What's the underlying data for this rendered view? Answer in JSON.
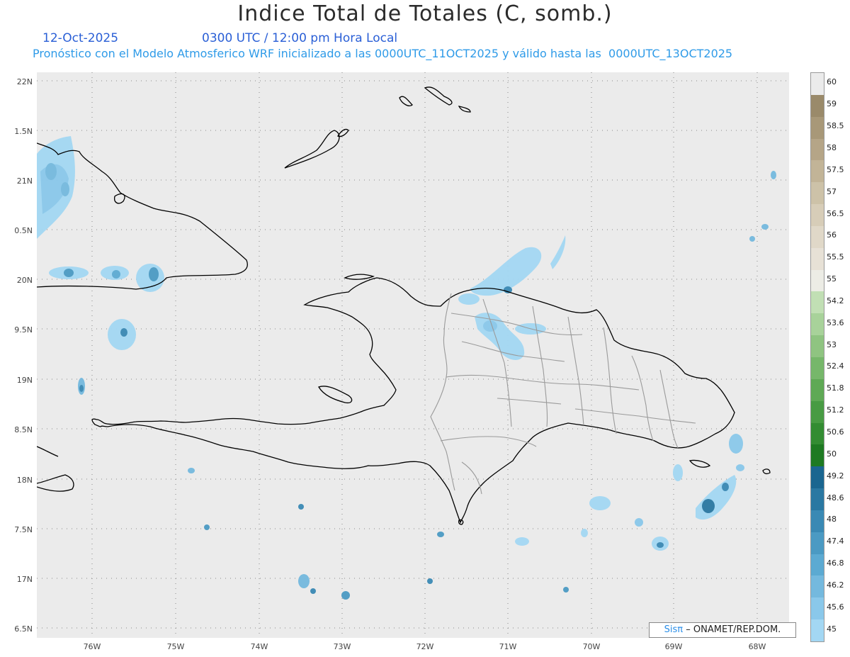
{
  "header": {
    "title": "Indice Total de Totales (C, somb.)",
    "date": "12-Oct-2025",
    "time": "0300 UTC / 12:00 pm Hora Local",
    "subtitle": "Pronóstico con el Modelo Atmosferico WRF inicializado a las 0000UTC_11OCT2025 y válido hasta las  0000UTC_13OCT2025"
  },
  "map": {
    "lat_labels": [
      "22N",
      "1.5N",
      "21N",
      "0.5N",
      "20N",
      "9.5N",
      "19N",
      "8.5N",
      "18N",
      "7.5N",
      "17N",
      "6.5N"
    ],
    "lon_labels": [
      "76W",
      "75W",
      "74W",
      "73W",
      "72W",
      "71W",
      "70W",
      "69W",
      "68W"
    ],
    "background_color": "#ebebeb",
    "coast_color": "#000000",
    "province_color": "#9a9a9a"
  },
  "colorbar": {
    "labels": [
      "60",
      "59",
      "58.5",
      "58",
      "57.5",
      "57",
      "56.5",
      "56",
      "55.5",
      "55",
      "54.2",
      "53.6",
      "53",
      "52.4",
      "51.8",
      "51.2",
      "50.6",
      "50",
      "49.2",
      "48.6",
      "48",
      "47.4",
      "46.8",
      "46.2",
      "45.6",
      "45"
    ],
    "colors": [
      "#ebebeb",
      "#9a8a6a",
      "#a89878",
      "#b5a587",
      "#c2b497",
      "#cdc2a8",
      "#d7cdb8",
      "#e0d8c8",
      "#e7e1d6",
      "#ecece5",
      "#c1dfb4",
      "#a8d29a",
      "#8fc481",
      "#76b76a",
      "#5fa955",
      "#489b43",
      "#338c32",
      "#1e7a22",
      "#1a6690",
      "#2a78a2",
      "#3a89b4",
      "#4b9ac3",
      "#5caad2",
      "#74b9de",
      "#8ac8ea",
      "#a3d7f3"
    ]
  },
  "credit": {
    "brand": "Sisπ",
    "text": "– ONAMET/REP.DOM."
  }
}
